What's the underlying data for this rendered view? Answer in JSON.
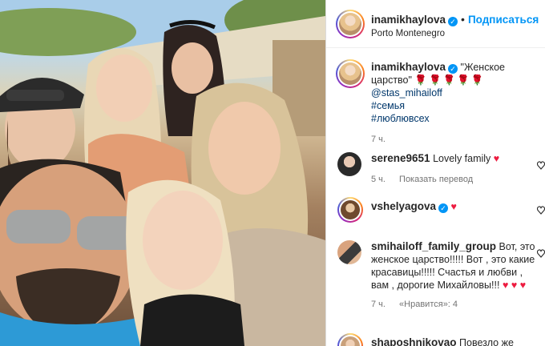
{
  "post": {
    "author": "inamikhaylova",
    "follow_label": "Подписаться",
    "separator": "•",
    "location": "Porto Montenegro",
    "caption_text": "\"Женское царство\"",
    "caption_roses": "🌹🌹🌹🌹🌹",
    "mention": "@stas_mihailoff",
    "hashtags": [
      "#семья",
      "#люблювсех"
    ],
    "time": "7 ч."
  },
  "comments": [
    {
      "username": "serene9651",
      "text": "Lovely family",
      "emoji": "♥",
      "time": "5 ч.",
      "action": "Показать перевод"
    },
    {
      "username": "vshelyagova",
      "text": "",
      "emoji": "♥",
      "verified": true
    },
    {
      "username": "smihailoff_family_group",
      "text": "Вот, это женское царство!!!!! Вот , это какие красавицы!!!!! Счастья и любви , вам , дорогие Михайловы!!!",
      "emoji": "♥ ♥ ♥",
      "time": "7 ч.",
      "likes": "«Нравится»: 4"
    },
    {
      "username": "shaposhnikovao",
      "text": "Повезло же"
    }
  ],
  "colors": {
    "link": "#0095f6",
    "hashtag": "#00376b",
    "muted": "#737373",
    "heart": "#ed1c40"
  },
  "icons": [
    "verified-icon",
    "heart-outline-icon",
    "heart-emoji-icon",
    "rose-emoji-icon"
  ]
}
